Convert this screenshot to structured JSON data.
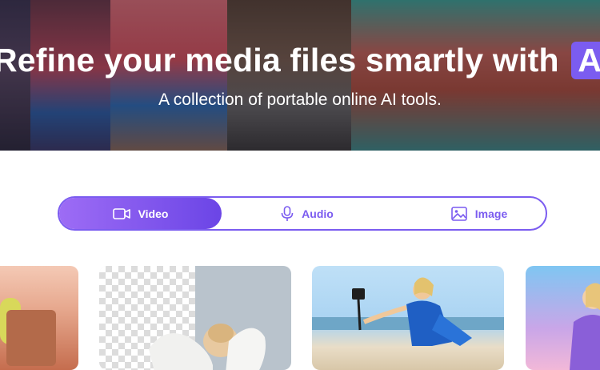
{
  "hero": {
    "title_main": "Refine your media files smartly with",
    "title_badge": "AI",
    "subtitle": "A collection of portable online AI tools."
  },
  "tabs": [
    {
      "label": "Video",
      "icon": "video-icon",
      "active": true
    },
    {
      "label": "Audio",
      "icon": "microphone-icon",
      "active": false
    },
    {
      "label": "Image",
      "icon": "image-icon",
      "active": false
    }
  ],
  "colors": {
    "accent": "#7b5cf0",
    "accent_gradient_start": "#9d6cf5",
    "accent_gradient_end": "#6b45e6"
  }
}
